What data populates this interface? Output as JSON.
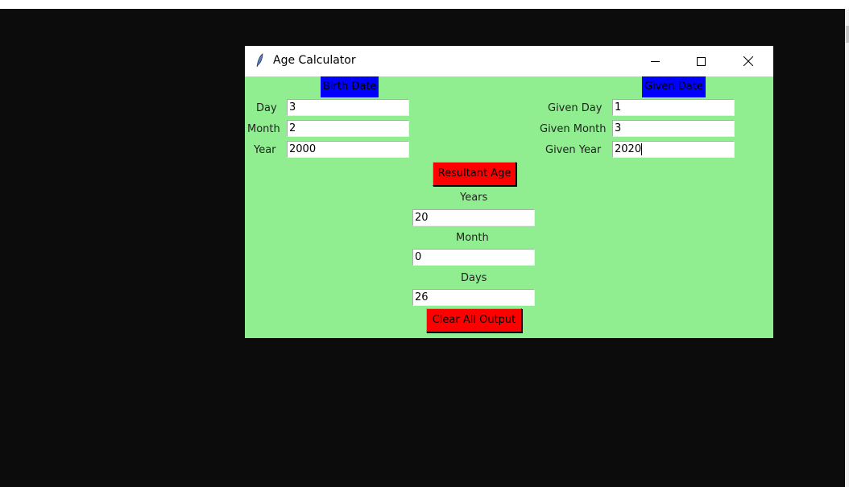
{
  "window": {
    "title": "Age Calculator",
    "icon": "feather-icon",
    "bg_color": "#90ee90"
  },
  "birth": {
    "header": "Birth Date",
    "day_label": "Day",
    "day": "3",
    "month_label": "Month",
    "month": "2",
    "year_label": "Year",
    "year": "2000"
  },
  "given": {
    "header": "Given Date",
    "day_label": "Given Day",
    "day": "1",
    "month_label": "Given Month",
    "month": "3",
    "year_label": "Given Year",
    "year": "2020"
  },
  "result": {
    "button": "Resultant Age",
    "years_label": "Years",
    "years": "20",
    "months_label": "Month",
    "months": "0",
    "days_label": "Days",
    "days": "26"
  },
  "clear_button": "Clear All Output",
  "colors": {
    "header": "#0000ff",
    "button": "#ff0000"
  }
}
